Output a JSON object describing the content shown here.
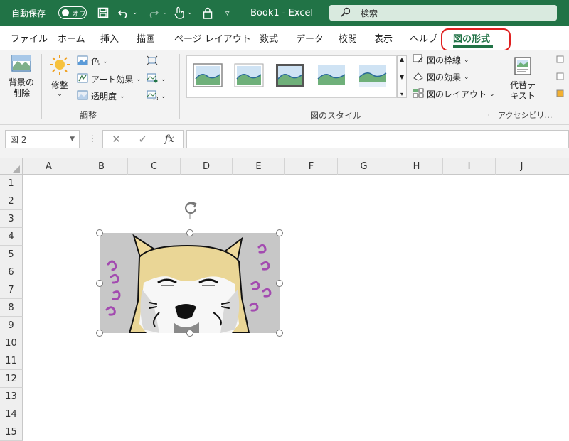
{
  "titlebar": {
    "autosave_label": "自動保存",
    "autosave_state": "オフ",
    "title": "Book1  -  Excel",
    "search_placeholder": "検索",
    "bg_color": "#217346"
  },
  "tabs": [
    {
      "label": "ファイル"
    },
    {
      "label": "ホーム"
    },
    {
      "label": "挿入"
    },
    {
      "label": "描画"
    },
    {
      "label": "ページ レイアウト"
    },
    {
      "label": "数式"
    },
    {
      "label": "データ"
    },
    {
      "label": "校閲"
    },
    {
      "label": "表示"
    },
    {
      "label": "ヘルプ"
    },
    {
      "label": "図の形式",
      "active": true
    }
  ],
  "ribbon": {
    "remove_bg": "背景の\n削除",
    "remove_bg_line1": "背景の",
    "remove_bg_line2": "削除",
    "corrections": "修整",
    "color": "色",
    "artistic": "アート効果",
    "transparency": "透明度",
    "adjust_group": "調整",
    "picture_border": "図の枠線",
    "picture_effects": "図の効果",
    "picture_layout": "図のレイアウト",
    "styles_group": "図のスタイル",
    "alt_text_line1": "代替テ",
    "alt_text_line2": "キスト",
    "accessibility_group": "アクセシビリ…"
  },
  "formula_bar": {
    "name_box": "図 2",
    "fx": "fx",
    "formula": ""
  },
  "grid": {
    "columns": [
      "A",
      "B",
      "C",
      "D",
      "E",
      "F",
      "G",
      "H",
      "I",
      "J"
    ],
    "rows": [
      "1",
      "2",
      "3",
      "4",
      "5",
      "6",
      "7",
      "8",
      "9",
      "10",
      "11",
      "12",
      "13",
      "14",
      "15"
    ]
  },
  "colors": {
    "accent": "#217346",
    "highlight_oval": "#e02020"
  }
}
